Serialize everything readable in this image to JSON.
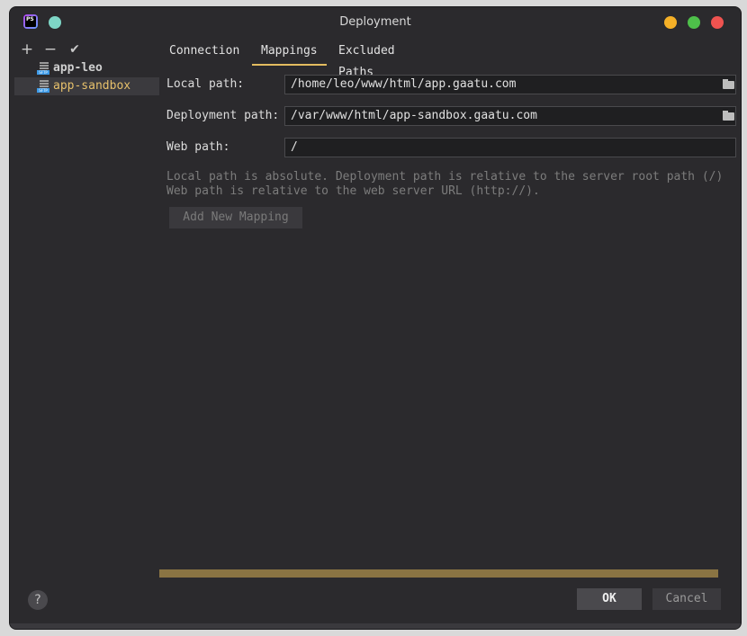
{
  "window": {
    "title": "Deployment"
  },
  "toolbar": {
    "add": "+",
    "remove": "−",
    "apply": "✔"
  },
  "servers": [
    {
      "name": "app-leo",
      "selected": false
    },
    {
      "name": "app-sandbox",
      "selected": true
    }
  ],
  "tabs": [
    {
      "label": "Connection",
      "active": false
    },
    {
      "label": "Mappings",
      "active": true
    },
    {
      "label": "Excluded Paths",
      "active": false
    }
  ],
  "mappings": {
    "local_label": "Local path:",
    "local_value": "/home/leo/www/html/app.gaatu.com",
    "deploy_label": "Deployment path:",
    "deploy_value": "/var/www/html/app-sandbox.gaatu.com",
    "web_label": "Web path:",
    "web_value": "/",
    "hint_line1": "Local path is absolute. Deployment path is relative to the server root path (/)",
    "hint_line2": "Web path is relative to the web server URL (http://).",
    "add_button": "Add New Mapping"
  },
  "footer": {
    "help": "?",
    "ok": "OK",
    "cancel": "Cancel"
  },
  "colors": {
    "accent": "#e3bc5f",
    "background": "#2b2a2d",
    "progress": "#8a7443"
  }
}
